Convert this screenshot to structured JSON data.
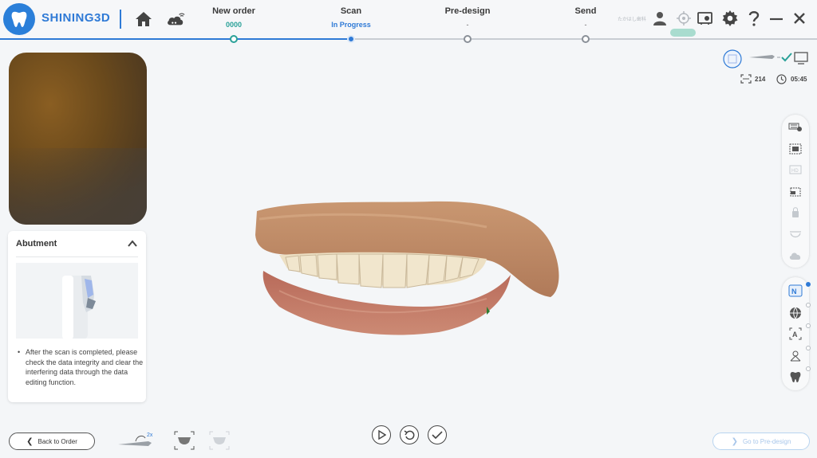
{
  "header": {
    "brand": "SHINING3D",
    "tiny_label": "たかはし歯科",
    "steps": [
      {
        "title": "New order",
        "sub": "0000"
      },
      {
        "title": "Scan",
        "sub": "In Progress"
      },
      {
        "title": "Pre-design",
        "sub": "-"
      },
      {
        "title": "Send",
        "sub": "-"
      }
    ]
  },
  "status": {
    "frame_count": "214",
    "timer": "05:45"
  },
  "panel": {
    "title": "Abutment",
    "tip": "After the scan is completed, please check the data integrity and clear the interfering data through the data editing function."
  },
  "bottom": {
    "back_label": "Back to Order",
    "next_label": "Go to Pre-design",
    "scanner_mode": "2x"
  },
  "colors": {
    "brand_blue": "#2f7ad6",
    "step_done": "#2aa198",
    "bg": "#f4f6f8"
  }
}
